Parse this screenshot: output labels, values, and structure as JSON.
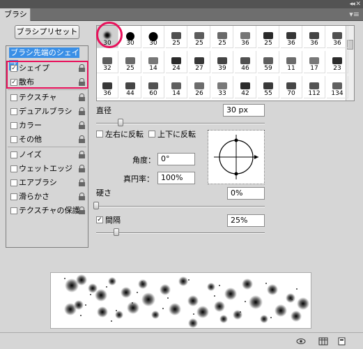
{
  "window": {
    "tab_label": "ブラシ",
    "collapse_glyph": "◂◂ ✕",
    "menu_glyph": "▾≡"
  },
  "preset_button": "ブラシプリセット",
  "options": {
    "header": "ブラシ先端のシェイプ",
    "items": [
      {
        "label": "シェイプ",
        "checked": true
      },
      {
        "label": "散布",
        "checked": true
      },
      {
        "label": "テクスチャ",
        "checked": false
      },
      {
        "label": "デュアルブラシ",
        "checked": false
      },
      {
        "label": "カラー",
        "checked": false
      },
      {
        "label": "その他",
        "checked": false
      },
      {
        "label": "ノイズ",
        "checked": false
      },
      {
        "label": "ウェットエッジ",
        "checked": false
      },
      {
        "label": "エアブラシ",
        "checked": false
      },
      {
        "label": "滑らかさ",
        "checked": false
      },
      {
        "label": "テクスチャの保護",
        "checked": false
      }
    ]
  },
  "brush_grid": {
    "rows": [
      [
        "30",
        "30",
        "30",
        "25",
        "25",
        "25",
        "36",
        "25",
        "36",
        "36",
        "36"
      ],
      [
        "32",
        "25",
        "14",
        "24",
        "27",
        "39",
        "46",
        "59",
        "11",
        "17",
        "23"
      ],
      [
        "36",
        "44",
        "60",
        "14",
        "26",
        "33",
        "42",
        "55",
        "70",
        "112",
        "134"
      ]
    ],
    "selected_index": 0
  },
  "settings": {
    "diameter_label": "直径",
    "diameter_value": "30 px",
    "flip_x_label": "左右に反転",
    "flip_y_label": "上下に反転",
    "angle_label": "角度：",
    "angle_value": "0°",
    "roundness_label": "真円率：",
    "roundness_value": "100%",
    "hardness_label": "硬さ",
    "hardness_value": "0%",
    "spacing_label": "間隔",
    "spacing_checked": true,
    "spacing_value": "25%"
  },
  "colors": {
    "highlight": "#e8105a",
    "selection": "#3a8fe6"
  },
  "icons": [
    "eye-icon",
    "grid-icon",
    "new-preset-icon"
  ]
}
